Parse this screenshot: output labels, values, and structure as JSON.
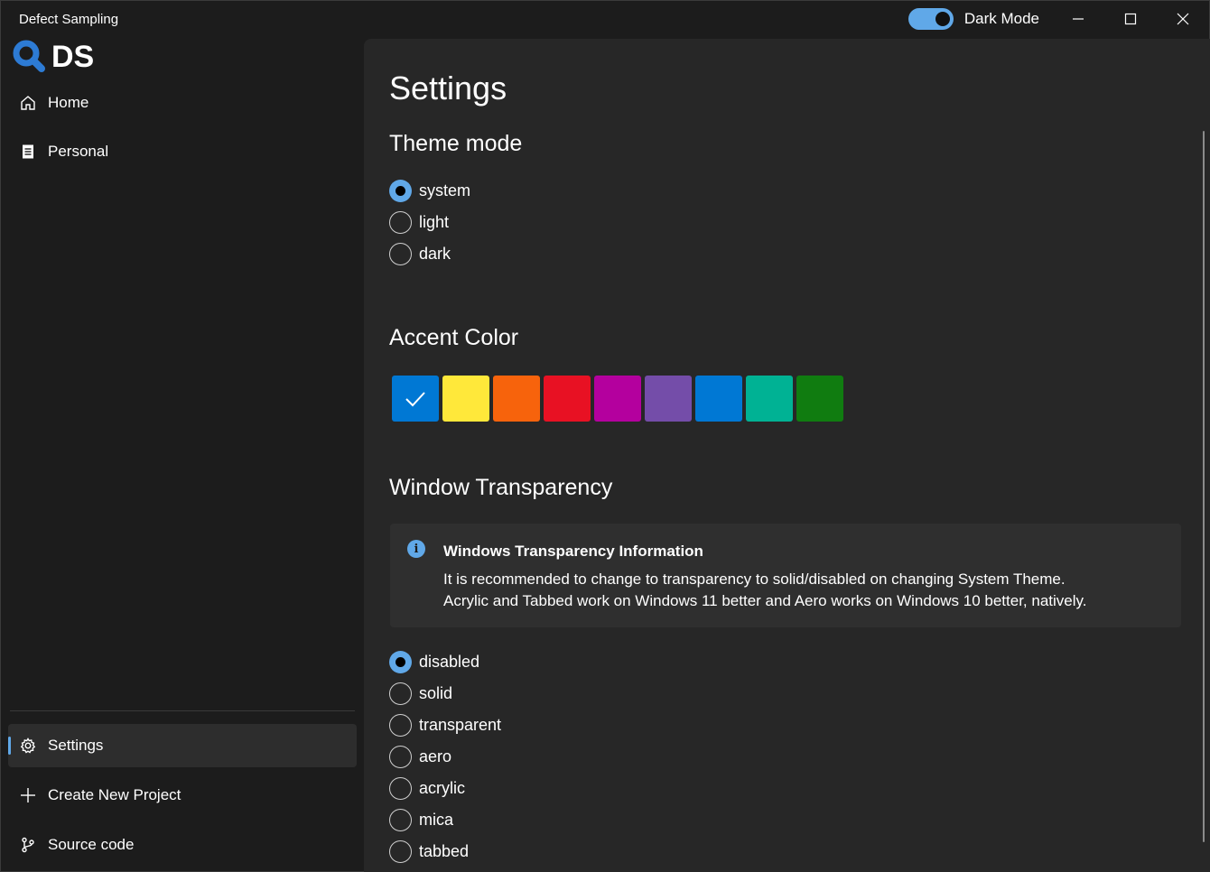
{
  "app": {
    "title": "Defect Sampling",
    "logo_text": "DS"
  },
  "titlebar": {
    "dark_mode_label": "Dark Mode",
    "dark_mode_on": true
  },
  "sidebar": {
    "items": [
      {
        "label": "Home",
        "icon": "home-icon"
      },
      {
        "label": "Personal",
        "icon": "document-icon"
      }
    ],
    "footer_items": [
      {
        "label": "Settings",
        "icon": "gear-icon",
        "active": true
      },
      {
        "label": "Create New Project",
        "icon": "plus-icon"
      },
      {
        "label": "Source code",
        "icon": "git-branch-icon"
      }
    ]
  },
  "settings": {
    "title": "Settings",
    "theme": {
      "heading": "Theme mode",
      "options": [
        "system",
        "light",
        "dark"
      ],
      "selected": "system"
    },
    "accent": {
      "heading": "Accent Color",
      "colors": [
        "#0078d4",
        "#ffe83a",
        "#f7630c",
        "#e81123",
        "#b4009e",
        "#744da9",
        "#0078d4",
        "#00b294",
        "#107c10"
      ],
      "selected_index": 0
    },
    "transparency": {
      "heading": "Window Transparency",
      "info_title": "Windows Transparency Information",
      "info_line1": "It is recommended to change to transparency to solid/disabled on changing System Theme.",
      "info_line2": "Acrylic and Tabbed work on Windows 11 better and Aero works on Windows 10 better, natively.",
      "options": [
        "disabled",
        "solid",
        "transparent",
        "aero",
        "acrylic",
        "mica",
        "tabbed"
      ],
      "selected": "disabled"
    }
  }
}
